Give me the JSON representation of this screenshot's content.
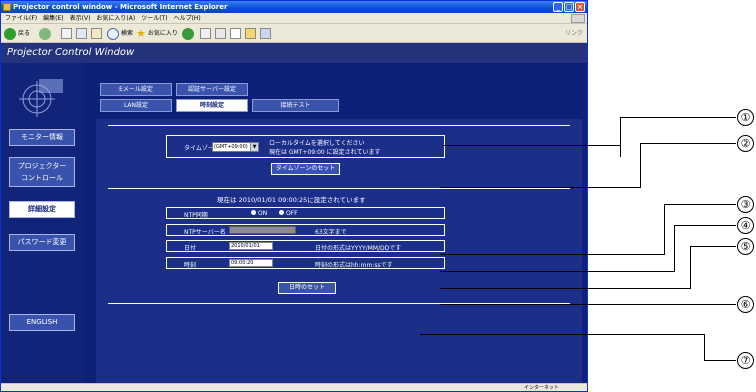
{
  "window": {
    "title": "Projector control window - Microsoft Internet Explorer"
  },
  "menu": [
    "ファイル(F)",
    "編集(E)",
    "表示(V)",
    "お気に入り(A)",
    "ツール(T)",
    "ヘルプ(H)"
  ],
  "toolbar": {
    "back": "戻る",
    "search": "検索",
    "favorites": "お気に入り",
    "links": "リンク"
  },
  "app_title": "Projector Control Window",
  "tabs_row1": [
    "Eメール設定",
    "認証サーバー設定"
  ],
  "tabs_row2": [
    "LAN設定",
    "時刻設定",
    "接続テスト"
  ],
  "sidebar": {
    "monitor": "モニター情報",
    "projector_control_l1": "プロジェクター",
    "projector_control_l2": "コントロール",
    "detail": "詳細設定",
    "password": "パスワード変更",
    "english": "ENGLISH"
  },
  "timezone": {
    "label": "タイムゾーン",
    "value": "(GMT+09:00)",
    "hint1": "ローカルタイムを選択してください",
    "hint2": "現在は GMT+09:00 に設定されています",
    "set_button": "タイムゾーンのセット"
  },
  "current": "現在は 2010/01/01 09:00:25に設定されています",
  "ntp": {
    "label": "NTP同期",
    "on": "ON",
    "off": "OFF"
  },
  "ntp_server": {
    "label": "NTPサーバー名",
    "hint": "63文字まで"
  },
  "date": {
    "label": "日付",
    "value": "2010/01/01",
    "hint": "日付の形式はYYYY/MM/DDです"
  },
  "time": {
    "label": "時刻",
    "value": "09:00:20",
    "hint": "時刻の形式はhh:mm:ssです"
  },
  "datetime_button": "日時のセット",
  "status_zone": "インターネット",
  "callouts": [
    "①",
    "②",
    "③",
    "④",
    "⑤",
    "⑥",
    "⑦"
  ]
}
